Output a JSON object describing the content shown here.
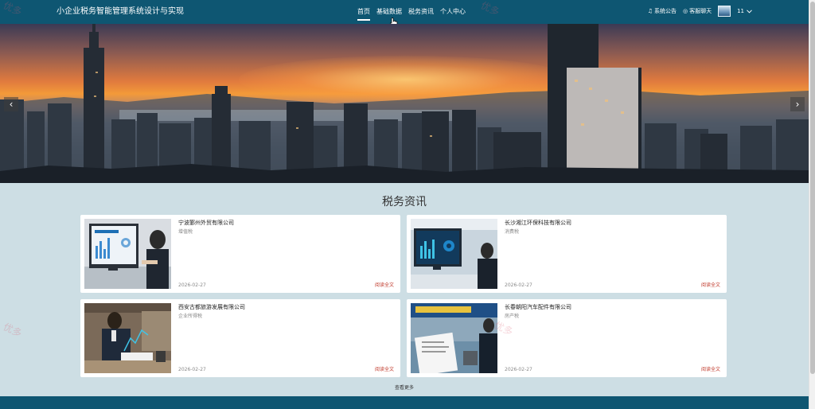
{
  "header": {
    "site_title": "小企业税务智能管理系统设计与实现",
    "nav": [
      {
        "label": "首页"
      },
      {
        "label": "基础数据"
      },
      {
        "label": "税务资讯"
      },
      {
        "label": "个人中心"
      }
    ],
    "announcement": "系统公告",
    "service_chat": "客服聊天",
    "username": "11"
  },
  "banner": {
    "prev_icon": "‹",
    "next_icon": "›"
  },
  "section": {
    "title": "税务资讯",
    "cards": [
      {
        "title": "宁波鄞州外贸有限公司",
        "subtitle": "增值税",
        "date": "2026-02-27",
        "read_more": "阅读全文"
      },
      {
        "title": "长沙湘江环保科技有限公司",
        "subtitle": "消费税",
        "date": "2026-02-27",
        "read_more": "阅读全文"
      },
      {
        "title": "西安古都旅游发展有限公司",
        "subtitle": "企业所得税",
        "date": "2026-02-27",
        "read_more": "阅读全文"
      },
      {
        "title": "长春朝阳汽车配件有限公司",
        "subtitle": "房产税",
        "date": "2026-02-27",
        "read_more": "阅读全文"
      }
    ],
    "view_more": "查看更多"
  },
  "watermark_text": "优多",
  "colors": {
    "header_bg": "#0e5672",
    "section_bg": "#cddee4",
    "read_more": "#c0392b"
  }
}
